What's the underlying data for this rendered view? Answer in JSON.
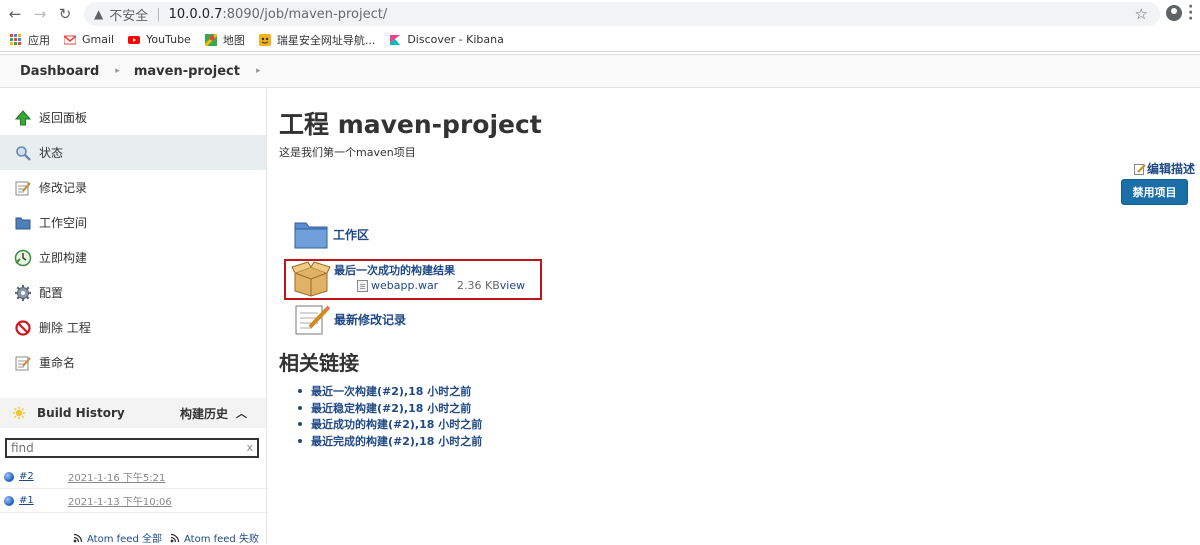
{
  "browser": {
    "security_label": "不安全",
    "url_host": "10.0.0.7",
    "url_rest": ":8090/job/maven-project/",
    "bookmarks": [
      {
        "label": "应用",
        "icon": "apps-grid-icon"
      },
      {
        "label": "Gmail",
        "icon": "gmail-icon"
      },
      {
        "label": "YouTube",
        "icon": "youtube-icon"
      },
      {
        "label": "地图",
        "icon": "maps-icon"
      },
      {
        "label": "瑞星安全网址导航...",
        "icon": "rising-icon"
      },
      {
        "label": "Discover - Kibana",
        "icon": "kibana-icon"
      }
    ]
  },
  "breadcrumb": {
    "items": [
      "Dashboard",
      "maven-project"
    ],
    "separator": "›"
  },
  "sidebar": {
    "tasks": [
      {
        "label": "返回面板",
        "icon": "up-arrow-icon"
      },
      {
        "label": "状态",
        "icon": "search-icon"
      },
      {
        "label": "修改记录",
        "icon": "notepad-icon"
      },
      {
        "label": "工作空间",
        "icon": "folder-icon"
      },
      {
        "label": "立即构建",
        "icon": "clock-icon"
      },
      {
        "label": "配置",
        "icon": "gear-icon"
      },
      {
        "label": "删除 工程",
        "icon": "no-entry-icon"
      },
      {
        "label": "重命名",
        "icon": "notepad-icon"
      }
    ]
  },
  "build_history": {
    "title": "Build History",
    "title_cn": "构建历史",
    "search_placeholder": "find",
    "clear_glyph": "x",
    "builds": [
      {
        "number": "#2",
        "date": "2021-1-16 下午5:21"
      },
      {
        "number": "#1",
        "date": "2021-1-13 下午10:06"
      }
    ],
    "feeds": [
      {
        "label": "Atom feed 全部"
      },
      {
        "label": "Atom feed 失败"
      }
    ]
  },
  "main": {
    "title": "工程 maven-project",
    "description": "这是我们第一个maven项目",
    "edit_description": "编辑描述",
    "disable_button": "禁用项目",
    "workspace_link": "工作区",
    "last_successful_artifacts": "最后一次成功的构建结果",
    "artifact": {
      "file": "webapp.war",
      "size": "2.36 KB",
      "view": "view"
    },
    "recent_changes": "最新修改记录",
    "related_links_title": "相关链接",
    "permalinks": [
      "最近一次构建(#2),18 小时之前",
      "最近稳定构建(#2),18 小时之前",
      "最近成功的构建(#2),18 小时之前",
      "最近完成的构建(#2),18 小时之前"
    ]
  },
  "colors": {
    "link": "#204a87",
    "button": "#1a6fa8",
    "highlight_box": "#c0151a",
    "active_task": "#e8eef0"
  }
}
